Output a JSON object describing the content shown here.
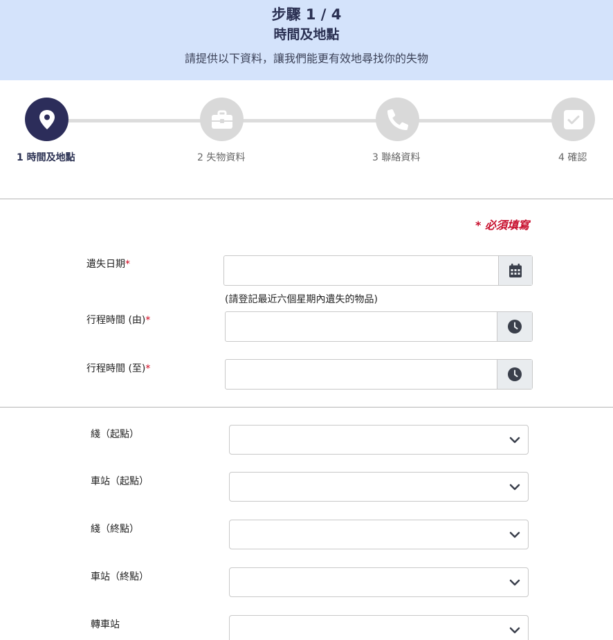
{
  "banner": {
    "step": "步驟 1 / 4",
    "title": "時間及地點",
    "subtitle": "請提供以下資料，讓我們能更有效地尋找你的失物"
  },
  "stepper": {
    "steps": [
      {
        "label": "1 時間及地點",
        "icon": "map-pin-icon",
        "active": true
      },
      {
        "label": "2 失物資料",
        "icon": "briefcase-icon",
        "active": false
      },
      {
        "label": "3 聯絡資料",
        "icon": "phone-icon",
        "active": false
      },
      {
        "label": "4 確認",
        "icon": "check-square-icon",
        "active": false
      }
    ]
  },
  "form": {
    "required_note": "* 必須填寫",
    "required_mark": "*",
    "lost_date": {
      "label": "遺失日期",
      "value": "",
      "hint": "(請登記最近六個星期內遺失的物品)"
    },
    "time_from": {
      "label": "行程時間 (由)",
      "value": ""
    },
    "time_to": {
      "label": "行程時間 (至)",
      "value": ""
    },
    "line_start": {
      "label": "綫（起點）",
      "value": ""
    },
    "station_start": {
      "label": "車站（起點）",
      "value": ""
    },
    "line_end": {
      "label": "綫（終點）",
      "value": ""
    },
    "station_end": {
      "label": "車站（終點）",
      "value": ""
    },
    "interchange": {
      "label": "轉車站",
      "value": ""
    }
  },
  "colors": {
    "banner_bg": "#d4e3fb",
    "active_step": "#2c2d5a",
    "inactive_step": "#d9d9d9",
    "required": "#c8102e"
  }
}
